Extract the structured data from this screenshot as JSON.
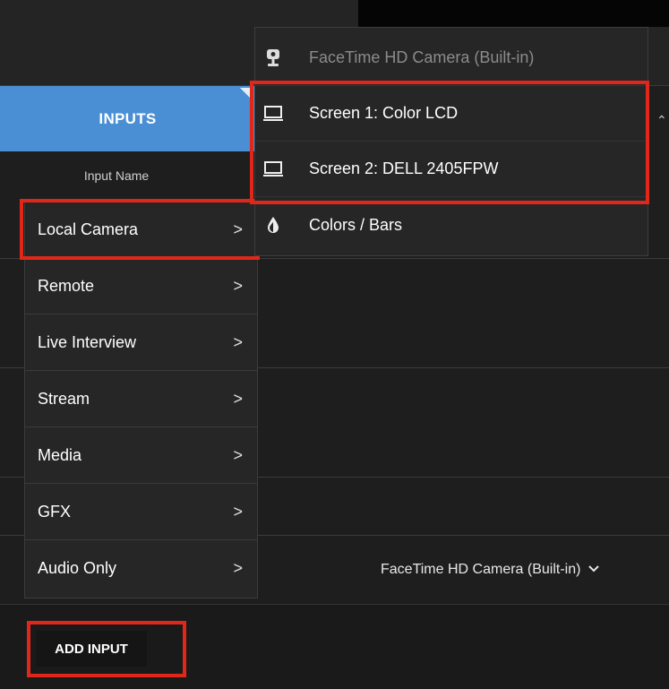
{
  "header": {
    "inputs_tab_label": "INPUTS",
    "column_label": "Input Name"
  },
  "add_menu": {
    "items": [
      {
        "label": "Local Camera",
        "chevron": ">"
      },
      {
        "label": "Remote",
        "chevron": ">"
      },
      {
        "label": "Live Interview",
        "chevron": ">"
      },
      {
        "label": "Stream",
        "chevron": ">"
      },
      {
        "label": "Media",
        "chevron": ">"
      },
      {
        "label": "GFX",
        "chevron": ">"
      },
      {
        "label": "Audio Only",
        "chevron": ">"
      }
    ]
  },
  "local_camera_submenu": {
    "items": [
      {
        "label": "FaceTime HD Camera (Built-in)",
        "icon": "webcam-icon",
        "disabled": true
      },
      {
        "label": "Screen 1: Color LCD",
        "icon": "laptop-screen-icon",
        "disabled": false
      },
      {
        "label": "Screen 2: DELL 2405FPW",
        "icon": "laptop-screen-icon",
        "disabled": false
      },
      {
        "label": "Colors / Bars",
        "icon": "color-drop-icon",
        "disabled": false
      }
    ]
  },
  "footer": {
    "selected_camera": "FaceTime HD Camera (Built-in)",
    "add_input_label": "ADD INPUT"
  },
  "colors": {
    "accent_blue": "#4a8fd4",
    "highlight_red": "#e0271a",
    "menu_bg": "#262626",
    "app_bg": "#1e1e1e"
  }
}
